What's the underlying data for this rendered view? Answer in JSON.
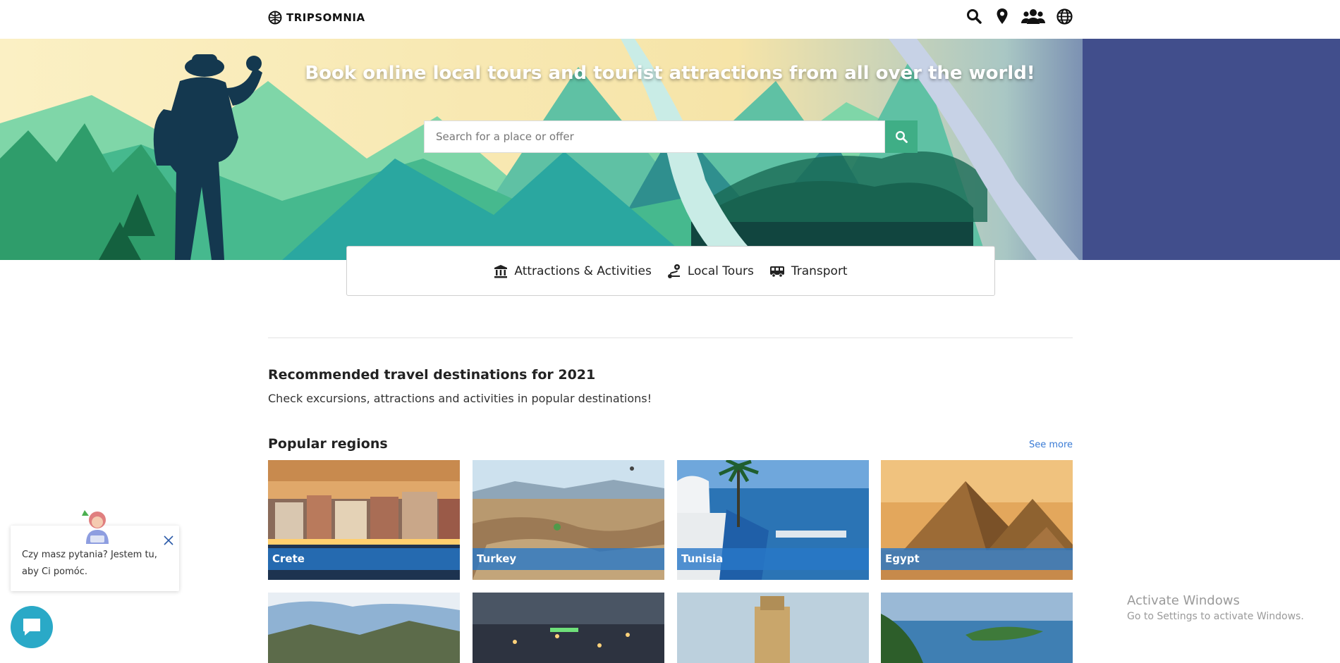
{
  "header": {
    "logo_text": "TRIPSOMNIA",
    "icons": [
      "search-icon",
      "location-icon",
      "users-icon",
      "globe-icon"
    ]
  },
  "hero": {
    "title": "Book online local tours and tourist attractions from all over the world!",
    "search_placeholder": "Search for a place or offer"
  },
  "categories": [
    {
      "label": "Attractions & Activities",
      "icon": "museum-icon"
    },
    {
      "label": "Local Tours",
      "icon": "route-icon"
    },
    {
      "label": "Transport",
      "icon": "bus-icon"
    }
  ],
  "recommended": {
    "title": "Recommended travel destinations for 2021",
    "subtitle": "Check excursions, attractions and activities in popular destinations!"
  },
  "popular": {
    "title": "Popular regions",
    "see_more": "See more",
    "regions": [
      "Crete",
      "Turkey",
      "Tunisia",
      "Egypt"
    ]
  },
  "chat": {
    "message": "Czy masz pytania? Jestem tu, aby Ci pomóc."
  },
  "windows_notice": {
    "line1": "Activate Windows",
    "line2": "Go to Settings to activate Windows."
  },
  "colors": {
    "accent": "#3fae86",
    "card_label_bg": "#2878c8",
    "link": "#3a7bd5",
    "chat_button": "#2aa9c7"
  }
}
